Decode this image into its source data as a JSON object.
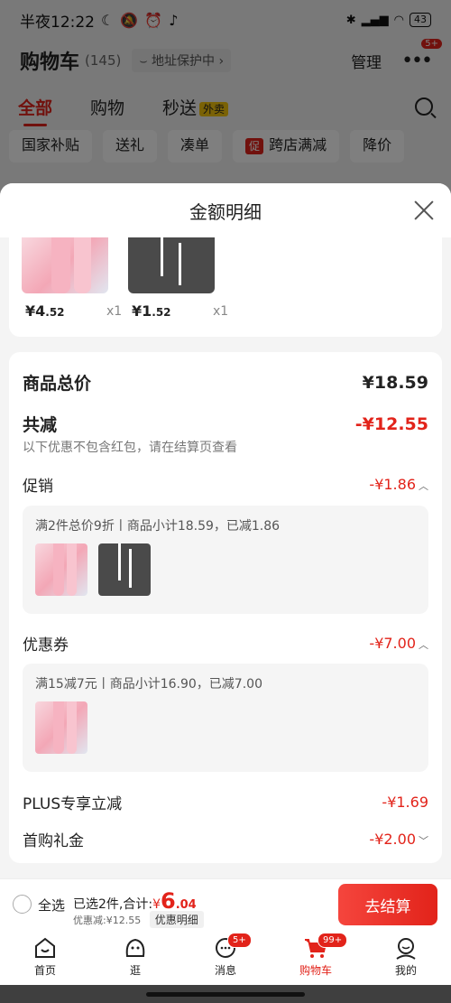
{
  "status": {
    "time": "半夜12:22",
    "battery": "43"
  },
  "cart": {
    "title": "购物车",
    "count": "(145)",
    "address": "地址保护中",
    "manage": "管理",
    "more_badge": "5+"
  },
  "tabs": [
    {
      "label": "全部"
    },
    {
      "label": "购物"
    },
    {
      "label": "秒送",
      "flag": "外卖"
    }
  ],
  "chips": [
    "国家补贴",
    "送礼",
    "凑单",
    "跨店满减",
    "降价"
  ],
  "chip_tag": "促",
  "sheet": {
    "title": "金额明细",
    "goods": [
      {
        "price_int": "¥4",
        "price_dec": ".52",
        "qty": "x1"
      },
      {
        "price_int": "¥1",
        "price_dec": ".52",
        "qty": "x1"
      }
    ],
    "total": {
      "label": "商品总价",
      "value": "¥18.59"
    },
    "discount": {
      "label": "共减",
      "value": "-¥12.55",
      "note": "以下优惠不包含红包，请在结算页查看"
    },
    "promo": {
      "label": "促销",
      "value": "-¥1.86",
      "detail": "满2件总价9折丨商品小计18.59，已减1.86"
    },
    "coupon": {
      "label": "优惠券",
      "value": "-¥7.00",
      "detail": "满15减7元丨商品小计16.90，已减7.00"
    },
    "plus": {
      "label": "PLUS专享立减",
      "value": "-¥1.69"
    },
    "firstbuy": {
      "label": "首购礼金",
      "value": "-¥2.00"
    }
  },
  "checkout": {
    "select_all": "全选",
    "selected_prefix": "已选2件,合计:",
    "currency": "¥",
    "amount_int": "6",
    "amount_dec": ".04",
    "discount_text": "优惠减:¥12.55",
    "detail_link": "优惠明细",
    "button": "去结算"
  },
  "tabbar": [
    {
      "label": "首页"
    },
    {
      "label": "逛"
    },
    {
      "label": "消息",
      "badge": "5+"
    },
    {
      "label": "购物车",
      "badge": "99+"
    },
    {
      "label": "我的"
    }
  ],
  "colors": {
    "accent": "#e2231a",
    "overlay": "rgba(0,0,0,0.5)"
  }
}
